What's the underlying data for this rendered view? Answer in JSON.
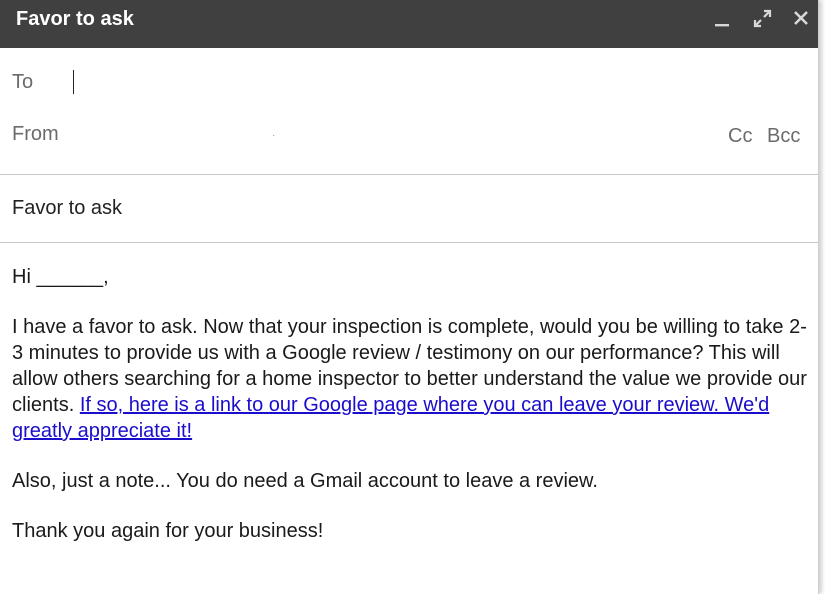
{
  "window": {
    "title": "Favor to ask",
    "controls": {
      "minimize_icon": "minimize-icon",
      "expand_icon": "expand-icon",
      "close_icon": "close-icon"
    },
    "colors": {
      "titlebar": "#404040",
      "link": "#1a0dcc"
    }
  },
  "recipients": {
    "to_label": "To",
    "to_value": "",
    "from_label": "From",
    "from_value": "·",
    "cc_label": "Cc",
    "bcc_label": "Bcc"
  },
  "subject": "Favor to ask",
  "body": {
    "greeting": "Hi ______,",
    "paragraph_main": "I have a favor to ask. Now that your inspection is complete, would you be willing to take 2-3 minutes to provide us with a Google review / testimony on our performance? This will allow others searching for a home inspector to better understand the value we provide our clients. ",
    "review_link": "If so, here is a link to our Google page where you can leave your review. We'd greatly appreciate it! ",
    "note": "Also, just a note... You do need a Gmail account to leave a review.",
    "closing": "Thank you again for your business!"
  }
}
